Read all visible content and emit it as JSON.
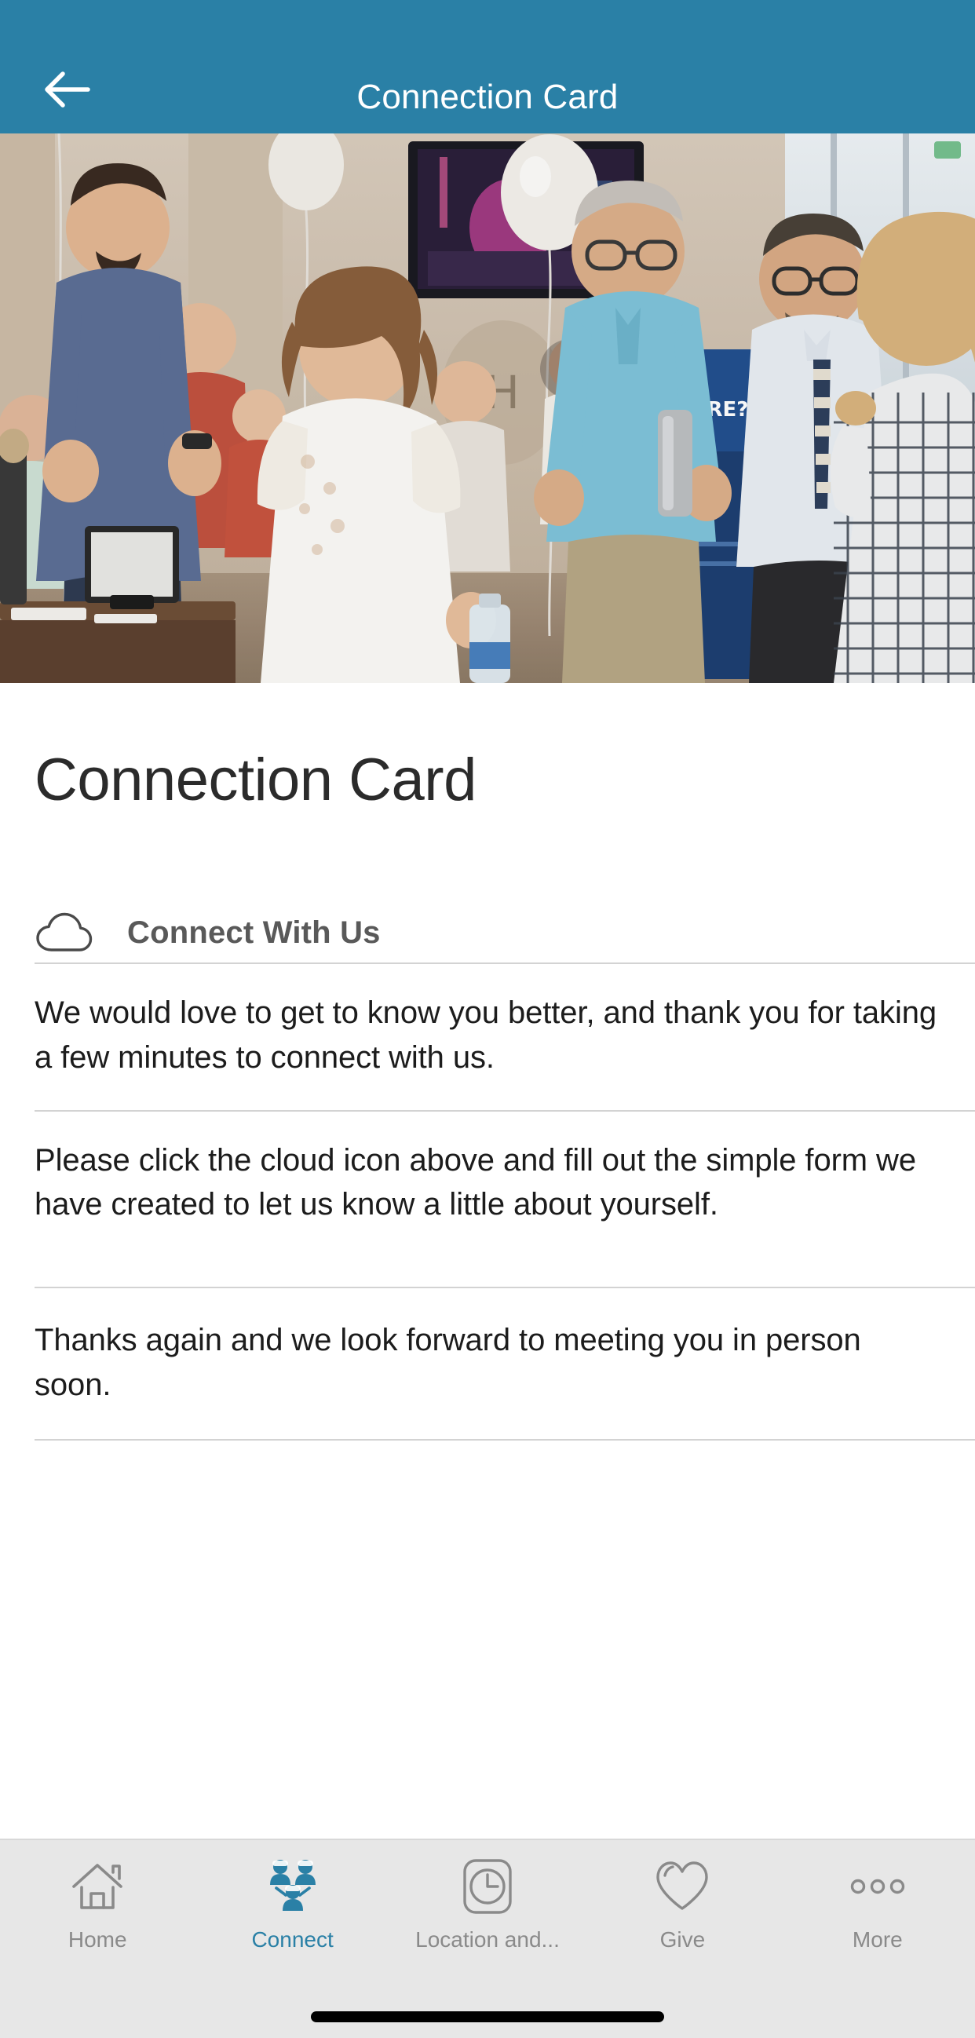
{
  "header": {
    "title": "Connection Card",
    "back_icon": "arrow-left-icon",
    "background_color": "#2A80A6",
    "text_color": "#FFFFFF"
  },
  "hero": {
    "alt": "Church lobby gathering with people greeting each other, balloons and welcome banner",
    "icon": "photo"
  },
  "main": {
    "page_title": "Connection Card",
    "section": {
      "icon": "cloud-icon",
      "label": "Connect With Us"
    },
    "paragraphs": [
      "We would love to get to know you better, and thank you for taking a few minutes to connect with us.",
      "Please click the cloud icon above and fill out the simple form we have created to let us know a little about yourself.",
      "Thanks again and we look forward to meeting you in person soon."
    ]
  },
  "tabbar": {
    "background_color": "#E7E7E7",
    "active_color": "#2A80A6",
    "inactive_color": "#8A8A8A",
    "items": [
      {
        "label": "Home",
        "icon": "home-icon",
        "active": false
      },
      {
        "label": "Connect",
        "icon": "people-group-icon",
        "active": true
      },
      {
        "label": "Location and...",
        "icon": "clock-icon",
        "active": false
      },
      {
        "label": "Give",
        "icon": "heart-icon",
        "active": false
      },
      {
        "label": "More",
        "icon": "ellipsis-icon",
        "active": false
      }
    ]
  }
}
